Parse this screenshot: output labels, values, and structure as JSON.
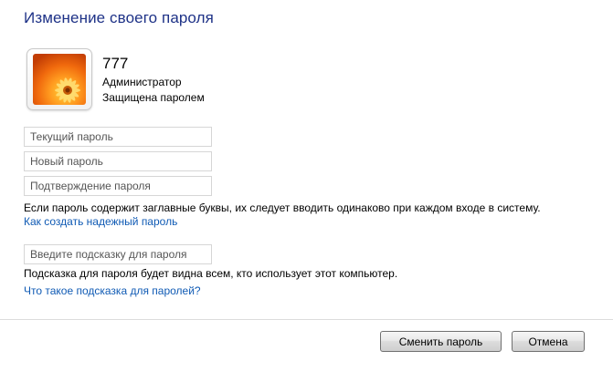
{
  "header": {
    "title": "Изменение своего пароля"
  },
  "user": {
    "name": "777",
    "role": "Администратор",
    "status": "Защищена паролем",
    "avatar_icon": "flower-avatar-icon"
  },
  "form": {
    "current_password": {
      "value": "",
      "placeholder": "Текущий пароль"
    },
    "new_password": {
      "value": "",
      "placeholder": "Новый пароль"
    },
    "confirm_password": {
      "value": "",
      "placeholder": "Подтверждение пароля"
    },
    "case_note": "Если пароль содержит заглавные буквы, их следует вводить одинаково при каждом входе в систему.",
    "strong_password_link": "Как создать надежный пароль",
    "hint": {
      "value": "",
      "placeholder": "Введите подсказку для пароля"
    },
    "hint_note": "Подсказка для пароля будет видна всем, кто использует этот компьютер.",
    "hint_link": "Что такое подсказка для паролей?"
  },
  "actions": {
    "change_label": "Сменить пароль",
    "cancel_label": "Отмена"
  },
  "colors": {
    "title": "#1e3287",
    "link": "#0f5ab4"
  }
}
